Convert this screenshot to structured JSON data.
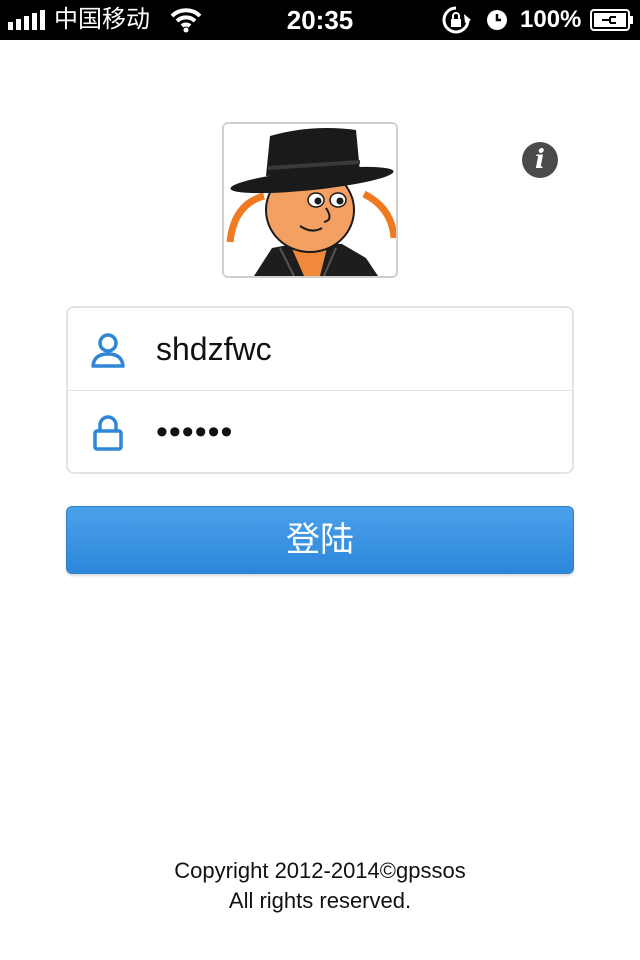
{
  "status_bar": {
    "carrier": "中国移动",
    "time": "20:35",
    "battery_percent": "100%",
    "icons": [
      "signal-bars-icon",
      "wifi-icon",
      "rotation-lock-icon",
      "alarm-icon",
      "battery-charging-icon"
    ]
  },
  "avatar": {
    "icon": "top-hat-mascot"
  },
  "info_button": {
    "label": "i",
    "icon": "info-icon"
  },
  "login_form": {
    "username": {
      "value": "shdzfwc",
      "icon": "user-icon"
    },
    "password": {
      "value": "••••••",
      "icon": "lock-icon"
    },
    "submit_label": "登陆"
  },
  "footer": {
    "copyright": "Copyright 2012-2014©gpssos",
    "rights": "All rights reserved."
  },
  "colors": {
    "accent": "#2e86db",
    "icon_blue": "#2f86d6",
    "status_bar_bg": "#000000",
    "border": "#e3e3e3"
  }
}
